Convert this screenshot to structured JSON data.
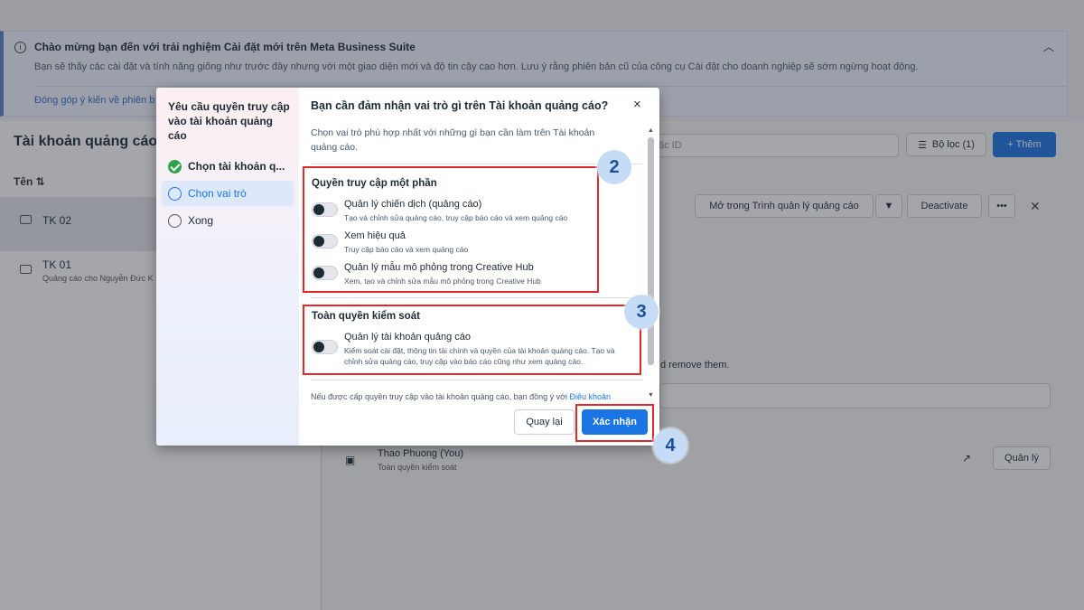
{
  "banner": {
    "title": "Chào mừng bạn đến với trải nghiệm Cài đặt mới trên Meta Business Suite",
    "body": "Bạn sẽ thấy các cài đặt và tính năng giống như trước đây nhưng với một giao diện mới và độ tin cậy cao hơn. Lưu ý rằng phiên bản cũ của công cụ Cài đặt cho doanh nghiệp sẽ sớm ngừng hoạt động.",
    "link": "Đóng góp ý kiến về phiên b"
  },
  "left_panel": {
    "title": "Tài khoản quảng cáo",
    "column_header": "Tên ⇅",
    "accounts": [
      {
        "name": "TK 02",
        "subtitle": ""
      },
      {
        "name": "TK 01",
        "subtitle": "Quảng cáo cho Nguyễn Đức K"
      }
    ]
  },
  "right_area": {
    "search_placeholder": "ặc ID",
    "filter_button": "Bộ lọc (1)",
    "add_button": "+ Thêm",
    "open_button": "Mở trong Trình quản lý quảng cáo",
    "deactivate_button": "Deactivate",
    "more_button": "•••",
    "remove_text": "d remove them.",
    "person_name": "Thao Phuong (You)",
    "person_role": "Toàn quyền kiểm soát",
    "manage_button": "Quản lý"
  },
  "modal": {
    "side_title": "Yêu cầu quyền truy cập vào tài khoản quảng cáo",
    "steps": [
      {
        "label": "Chọn tài khoản q...",
        "state": "done"
      },
      {
        "label": "Chọn vai trò",
        "state": "active"
      },
      {
        "label": "Xong",
        "state": "pending"
      }
    ],
    "title": "Bạn cần đảm nhận vai trò gì trên Tài khoản quảng cáo?",
    "description": "Chọn vai trò phù hợp nhất với những gì bạn cần làm trên Tài khoản quảng cáo.",
    "partial_section": {
      "title": "Quyền truy cập một phần",
      "options": [
        {
          "name": "Quản lý chiến dịch (quảng cáo)",
          "desc": "Tạo và chỉnh sửa quảng cáo, truy cập báo cáo và xem quảng cáo"
        },
        {
          "name": "Xem hiệu quả",
          "desc": "Truy cập báo cáo và xem quảng cáo"
        },
        {
          "name": "Quản lý mẫu mô phỏng trong Creative Hub",
          "desc": "Xem, tạo và chỉnh sửa mẫu mô phỏng trong Creative Hub"
        }
      ]
    },
    "full_section": {
      "title": "Toàn quyền kiểm soát",
      "options": [
        {
          "name": "Quản lý tài khoản quảng cáo",
          "desc": "Kiểm soát cài đặt, thông tin tài chính và quyền của tài khoản quảng cáo. Tạo và chỉnh sửa quảng cáo, truy cập vào báo cáo cũng như xem quảng cáo."
        }
      ]
    },
    "terms_prefix": "Nếu được cấp quyền truy cập vào tài khoản quảng cáo, bạn đồng ý với ",
    "terms_link": "Điều khoản",
    "back_button": "Quay lại",
    "confirm_button": "Xác nhận",
    "close_icon": "×"
  },
  "annotations": {
    "badges": [
      "2",
      "3",
      "4"
    ],
    "highlight_color": "#e0282d"
  },
  "colors": {
    "primary": "#1b74e4",
    "success": "#31a24c"
  }
}
